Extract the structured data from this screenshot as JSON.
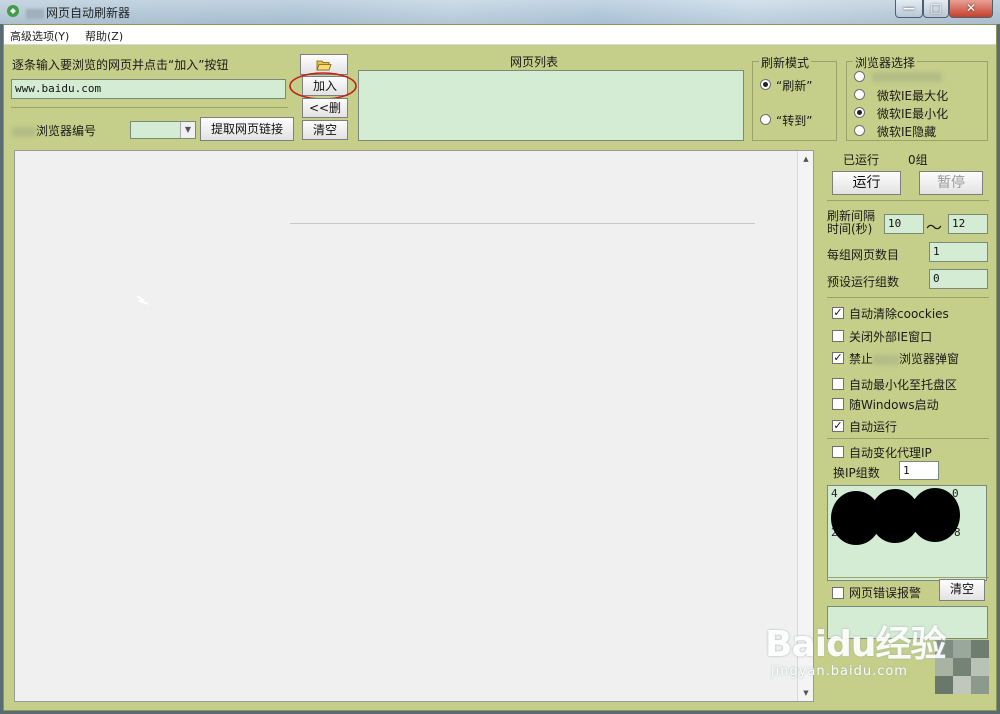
{
  "window": {
    "title": "网页自动刷新器",
    "minimize_label": "—",
    "maximize_label": "□",
    "close_label": "✕"
  },
  "menubar": {
    "items": [
      "高级选项(Y)",
      "帮助(Z)"
    ]
  },
  "top": {
    "instruction": "逐条输入要浏览的网页并点击“加入”按钮",
    "url_value": "www.baidu.com",
    "browser_id_label": "浏览器编号",
    "browser_id_value": "",
    "extract_button": "提取网页链接",
    "open_icon": "folder-open-icon",
    "add_button": "加入>>",
    "delete_button": "<<删除",
    "clear_button": "清空",
    "list_title": "网页列表"
  },
  "refresh_mode": {
    "title": "刷新模式",
    "options": [
      "“刷新”",
      "“转到”"
    ],
    "selected": 0
  },
  "browser_select": {
    "title": "浏览器选择",
    "options": [
      "微软IE最大化",
      "微软IE最小化",
      "微软IE隐藏"
    ],
    "selected": 1
  },
  "right_panel": {
    "run_status_label": "已运行",
    "run_status_value": "0组",
    "run_button": "运行",
    "pause_button": "暂停",
    "interval_label_1": "刷新间隔",
    "interval_label_2": "时间(秒)",
    "interval_min": "10",
    "interval_sep": "〜",
    "interval_max": "12",
    "pages_per_group_label": "每组网页数目",
    "pages_per_group_value": "1",
    "preset_groups_label": "预设运行组数",
    "preset_groups_value": "0",
    "options": [
      {
        "label": "自动清除coockies",
        "checked": true
      },
      {
        "label": "关闭外部IE窗口",
        "checked": false
      },
      {
        "label": "浏览器弹窗",
        "prefix": "禁止",
        "checked": true
      },
      {
        "label": "自动最小化至托盘区",
        "checked": false
      },
      {
        "label": "随Windows启动",
        "checked": false
      },
      {
        "label": "自动运行",
        "checked": true
      }
    ],
    "proxy_label": "自动变化代理IP",
    "proxy_checked": false,
    "switch_ip_label": "换IP组数",
    "switch_ip_value": "1",
    "ip_list_line1_start": "4",
    "ip_list_line1_end": "0",
    "ip_list_line2_start": "2",
    "ip_list_line2_end": "8",
    "error_alarm_label": "网页错误报警",
    "error_alarm_checked": false,
    "error_clear_button": "清空"
  },
  "watermark": {
    "brand": "Baidu经验",
    "url": "jingyan.baidu.com"
  }
}
